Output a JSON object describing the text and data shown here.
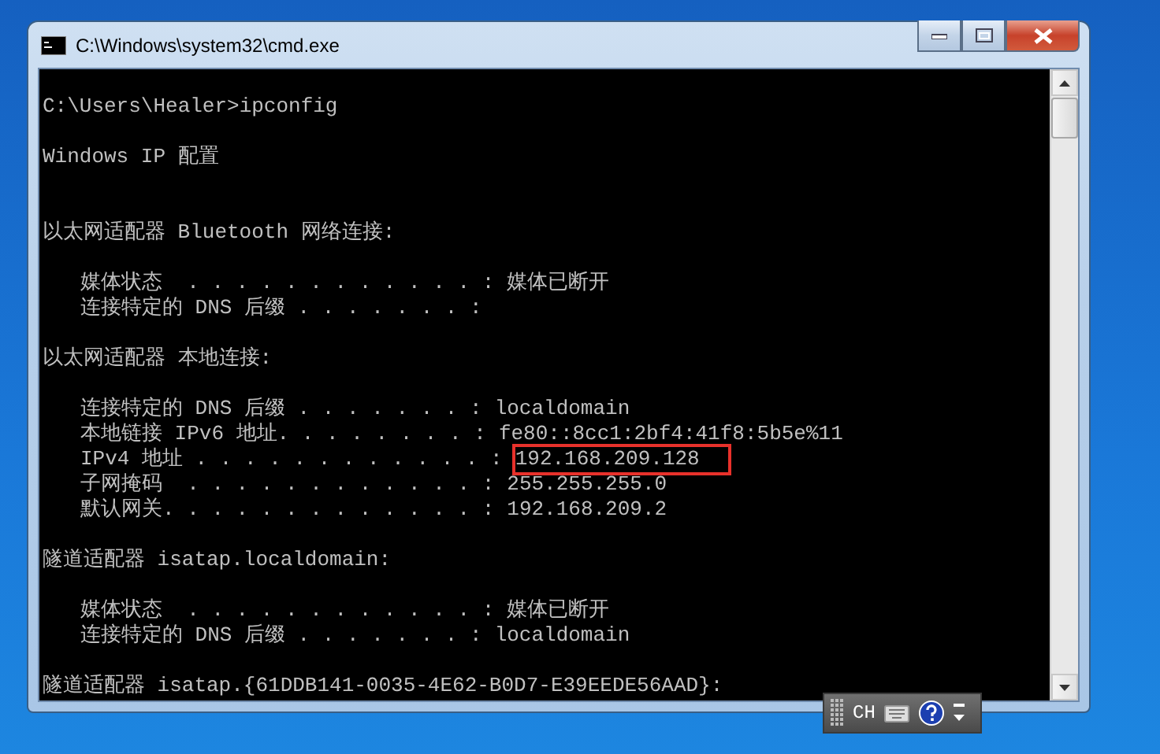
{
  "window": {
    "title": "C:\\Windows\\system32\\cmd.exe"
  },
  "console": {
    "command": "C:\\Users\\Healer>ipconfig",
    "heading": "Windows IP 配置",
    "sections": [
      {
        "header": "以太网适配器 Bluetooth 网络连接:",
        "entries": [
          {
            "label": "媒体状态  . . . . . . . . . . . . :",
            "value": "媒体已断开"
          },
          {
            "label": "连接特定的 DNS 后缀 . . . . . . . :"
          }
        ]
      },
      {
        "header": "以太网适配器 本地连接:",
        "entries": [
          {
            "label": "连接特定的 DNS 后缀 . . . . . . . :",
            "value": "localdomain"
          },
          {
            "label": "本地链接 IPv6 地址. . . . . . . . :",
            "value": "fe80::8cc1:2bf4:41f8:5b5e%11"
          },
          {
            "label": "IPv4 地址 . . . . . . . . . . . . :",
            "value": "192.168.209.128",
            "highlighted": true
          },
          {
            "label": "子网掩码  . . . . . . . . . . . . :",
            "value": "255.255.255.0"
          },
          {
            "label": "默认网关. . . . . . . . . . . . . :",
            "value": "192.168.209.2"
          }
        ]
      },
      {
        "header": "隧道适配器 isatap.localdomain:",
        "entries": [
          {
            "label": "媒体状态  . . . . . . . . . . . . :",
            "value": "媒体已断开"
          },
          {
            "label": "连接特定的 DNS 后缀 . . . . . . . :",
            "value": "localdomain"
          }
        ]
      },
      {
        "header": "隧道适配器 isatap.{61DDB141-0035-4E62-B0D7-E39EEDE56AAD}:"
      }
    ]
  },
  "language_bar": {
    "language": "CH"
  }
}
